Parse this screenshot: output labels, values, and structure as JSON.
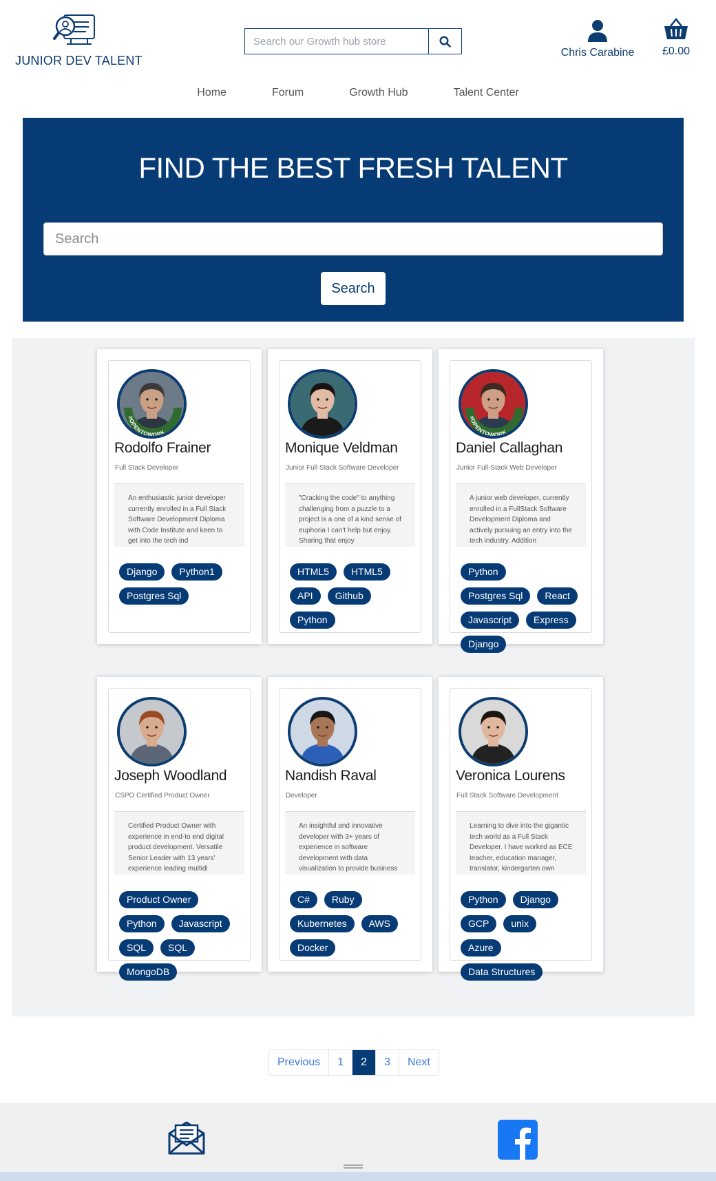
{
  "header": {
    "logo_text": "JUNIOR DEV TALENT",
    "store_search_placeholder": "Search our Growth hub store",
    "account_name": "Chris Carabine",
    "basket_total": "£0.00"
  },
  "nav": {
    "items": [
      "Home",
      "Forum",
      "Growth Hub",
      "Talent Center"
    ]
  },
  "hero": {
    "title": "FIND THE BEST FRESH TALENT",
    "search_placeholder": "Search",
    "search_button": "Search"
  },
  "colors": {
    "brand_navy": "#073b75",
    "page_gray": "#f1f2f4",
    "link_blue": "#3d7ae0"
  },
  "profiles": [
    {
      "name": "Rodolfo Frainer",
      "role": "Full Stack Developer",
      "bio": "An enthusiastic junior developer currently enrolled in a Full Stack Software Development Diploma with Code Institute and keen to get into the tech ind",
      "tags": [
        "Django",
        "Python1",
        "Postgres Sql"
      ],
      "badge": "#OPENTOWORK",
      "avatar_icon": "person-photo"
    },
    {
      "name": "Monique Veldman",
      "role": "Junior Full Stack Software Developer",
      "bio": "\"Cracking the code\" to anything challenging from a puzzle to a project is a one of a kind sense of euphoria I can't help but enjoy. Sharing that enjoy",
      "tags": [
        "HTML5",
        "HTML5",
        "API",
        "Github",
        "Python"
      ],
      "badge": "",
      "avatar_icon": "person-photo"
    },
    {
      "name": "Daniel Callaghan",
      "role": "Junior Full-Stack Web Developer",
      "bio": "A junior web developer, currently enrolled in a FullStack Software Development Diploma and actively pursuing an entry into the tech industry. Addition",
      "tags": [
        "Python",
        "Postgres Sql",
        "React",
        "Javascript",
        "Express",
        "Django"
      ],
      "badge": "#OPENTOWORK",
      "avatar_icon": "person-photo"
    },
    {
      "name": "Joseph Woodland",
      "role": "CSPO Certified Product Owner",
      "bio": "Certified Product Owner with experience in end-to end digital product development. Versatile Senior Leader with 13 years' experience leading multidi",
      "tags": [
        "Product Owner",
        "Python",
        "Javascript",
        "SQL",
        "SQL",
        "MongoDB"
      ],
      "badge": "",
      "avatar_icon": "person-photo"
    },
    {
      "name": "Nandish Raval",
      "role": "Developer",
      "bio": "An insightful and innovative developer with 3+ years of experience in software development with data visualization to provide business solutions. Reco",
      "tags": [
        "C#",
        "Ruby",
        "Kubernetes",
        "AWS",
        "Docker"
      ],
      "badge": "",
      "avatar_icon": "person-photo"
    },
    {
      "name": "Veronica Lourens",
      "role": "Full Stack Software Development",
      "bio": "Learning to dive into the gigantic tech world as a Full Stack Developer. I have worked as ECE teacher, education manager, translator, kindergarten own",
      "tags": [
        "Python",
        "Django",
        "GCP",
        "unix",
        "Azure",
        "Data Structures"
      ],
      "badge": "",
      "avatar_icon": "person-photo"
    }
  ],
  "pagination": {
    "previous": "Previous",
    "pages": [
      "1",
      "2",
      "3"
    ],
    "current": "2",
    "next": "Next"
  },
  "footer": {
    "icons": [
      "mail-icon",
      "facebook-icon"
    ]
  }
}
